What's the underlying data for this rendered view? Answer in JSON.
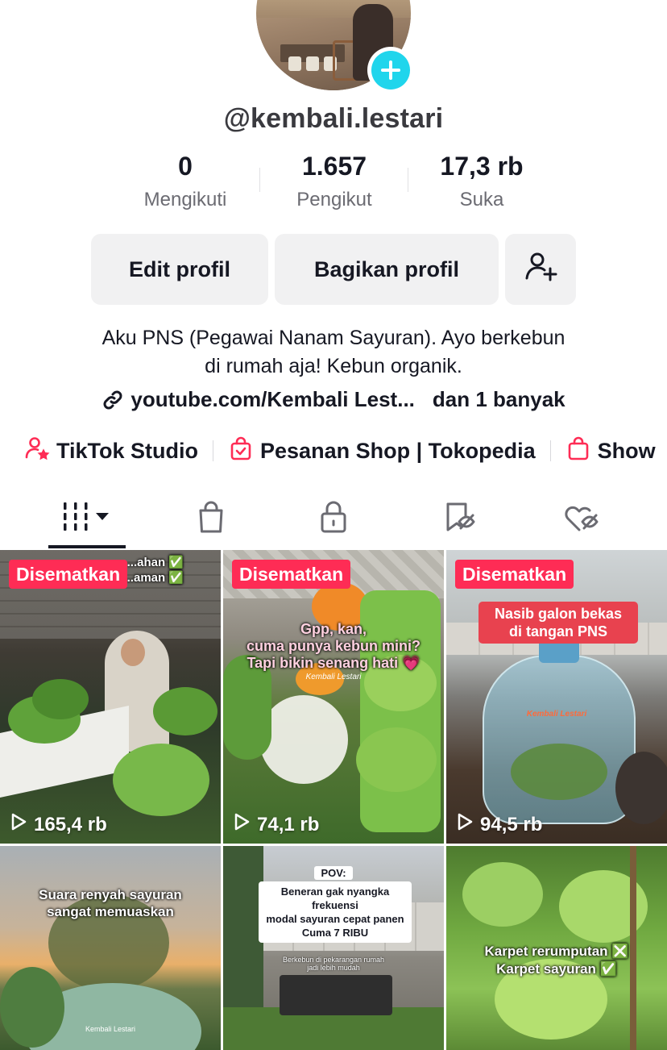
{
  "profile": {
    "username": "@kembali.lestari",
    "stats": [
      {
        "value": "0",
        "label": "Mengikuti"
      },
      {
        "value": "1.657",
        "label": "Pengikut"
      },
      {
        "value": "17,3 rb",
        "label": "Suka"
      }
    ],
    "edit_label": "Edit profil",
    "share_label": "Bagikan profil",
    "bio_line1": "Aku PNS (Pegawai Nanam Sayuran). Ayo berkebun",
    "bio_line2": "di rumah aja! Kebun organik.",
    "link_text": "youtube.com/Kembali Lest...",
    "link_more": "dan 1 banyak"
  },
  "shortcuts": [
    {
      "label": "TikTok Studio",
      "icon": "person-star-icon"
    },
    {
      "label": "Pesanan Shop | Tokopedia",
      "icon": "shopping-bag-check-icon"
    },
    {
      "label": "Show",
      "icon": "shopping-bag-icon"
    }
  ],
  "tabs": [
    {
      "icon": "videos-grid-icon",
      "active": true
    },
    {
      "icon": "shop-bag-icon"
    },
    {
      "icon": "lock-icon"
    },
    {
      "icon": "saved-icon"
    },
    {
      "icon": "liked-heart-icon"
    }
  ],
  "videos": [
    {
      "pinned": "Disematkan",
      "views": "165,4 rb",
      "caption": "...ahan ✅\n...aman ✅"
    },
    {
      "pinned": "Disematkan",
      "views": "74,1 rb",
      "caption": "Gpp, kan,\ncuma punya kebun mini?\nTapi bikin senang hati 💗",
      "watermark": "Kembali Lestari"
    },
    {
      "pinned": "Disematkan",
      "views": "94,5 rb",
      "caption": "Nasib galon bekas\ndi tangan PNS",
      "watermark": "Kembali Lestari"
    },
    {
      "caption": "Suara renyah sayuran\nsangat memuaskan",
      "subcaption": "Kembali Lestari"
    },
    {
      "caption_title": "POV:",
      "caption": "Beneran gak nyangka frekuensi\nmodal sayuran cepat panen\nCuma 7 RIBU",
      "subcaption": "Berkebun di pekarangan rumah\njadi lebih mudah"
    },
    {
      "caption": "Karpet rerumputan ❎\nKarpet sayuran ✅"
    }
  ],
  "colors": {
    "accent": "#fe2c55",
    "badge": "#20d5ec",
    "text": "#161823",
    "muted": "#6b6b72",
    "button_bg": "#f1f1f2"
  }
}
